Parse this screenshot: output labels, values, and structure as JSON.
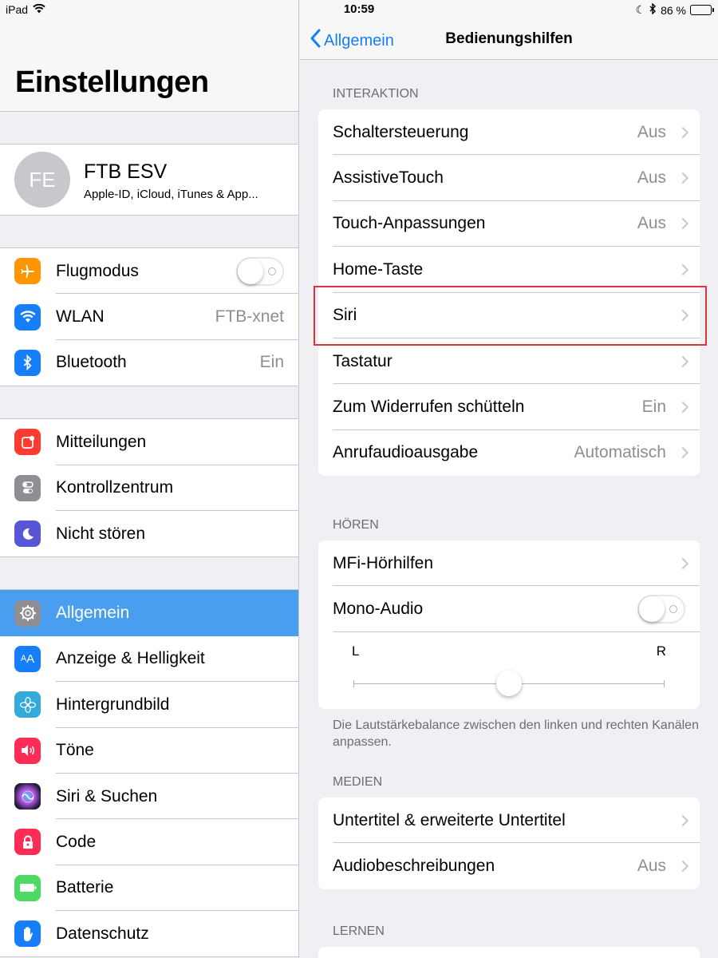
{
  "status": {
    "device": "iPad",
    "time": "10:59",
    "battery": "86 %"
  },
  "left": {
    "title": "Einstellungen",
    "profile": {
      "initials": "FE",
      "name": "FTB ESV",
      "subtitle": "Apple-ID, iCloud, iTunes & App..."
    },
    "groups": [
      [
        {
          "label": "Flugmodus",
          "icon": "airplane-icon",
          "color": "#ff9500",
          "toggle": true
        },
        {
          "label": "WLAN",
          "value": "FTB-xnet",
          "icon": "wifi-icon",
          "color": "#157efb"
        },
        {
          "label": "Bluetooth",
          "value": "Ein",
          "icon": "bluetooth-icon",
          "color": "#157efb"
        }
      ],
      [
        {
          "label": "Mitteilungen",
          "icon": "notifications-icon",
          "color": "#ff3b30"
        },
        {
          "label": "Kontrollzentrum",
          "icon": "control-center-icon",
          "color": "#8e8e93"
        },
        {
          "label": "Nicht stören",
          "icon": "moon-icon",
          "color": "#5856d6"
        }
      ],
      [
        {
          "label": "Allgemein",
          "icon": "gear-icon",
          "color": "#8e8e93",
          "selected": true
        },
        {
          "label": "Anzeige & Helligkeit",
          "icon": "text-size-icon",
          "color": "#157efb"
        },
        {
          "label": "Hintergrundbild",
          "icon": "wallpaper-icon",
          "color": "#34aadc"
        },
        {
          "label": "Töne",
          "icon": "speaker-icon",
          "color": "#ff2d55"
        },
        {
          "label": "Siri & Suchen",
          "icon": "siri-icon",
          "color": "#1c1c3a"
        },
        {
          "label": "Code",
          "icon": "lock-icon",
          "color": "#ff2d55"
        },
        {
          "label": "Batterie",
          "icon": "battery-icon",
          "color": "#4cd964"
        },
        {
          "label": "Datenschutz",
          "icon": "hand-icon",
          "color": "#157efb"
        }
      ]
    ]
  },
  "right": {
    "back_label": "Allgemein",
    "title": "Bedienungshilfen",
    "sections": {
      "interaction": {
        "header": "INTERAKTION",
        "rows": [
          {
            "label": "Schaltersteuerung",
            "value": "Aus"
          },
          {
            "label": "AssistiveTouch",
            "value": "Aus"
          },
          {
            "label": "Touch-Anpassungen",
            "value": "Aus"
          },
          {
            "label": "Home-Taste",
            "value": ""
          },
          {
            "label": "Siri",
            "value": ""
          },
          {
            "label": "Tastatur",
            "value": ""
          },
          {
            "label": "Zum Widerrufen schütteln",
            "value": "Ein"
          },
          {
            "label": "Anrufaudioausgabe",
            "value": "Automatisch"
          }
        ]
      },
      "hearing": {
        "header": "HÖREN",
        "mfi": "MFi-Hörhilfen",
        "mono": "Mono-Audio",
        "balance_left": "L",
        "balance_right": "R",
        "balance_value": 0.5,
        "footnote": "Die Lautstärkebalance zwischen den linken und rechten Kanälen anpassen."
      },
      "media": {
        "header": "MEDIEN",
        "rows": [
          {
            "label": "Untertitel & erweiterte Untertitel",
            "value": ""
          },
          {
            "label": "Audiobeschreibungen",
            "value": "Aus"
          }
        ]
      },
      "learning": {
        "header": "LERNEN"
      }
    }
  }
}
